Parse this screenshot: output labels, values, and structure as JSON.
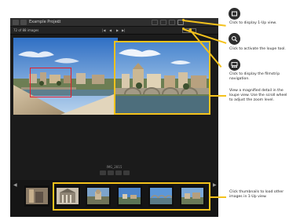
{
  "app": {
    "project_title": "Example Project",
    "count_label": "72 of 88 images",
    "filename": "IMG_2815"
  },
  "nav": {
    "first": "|◀",
    "prev": "◀",
    "next": "▶",
    "last": "▶|"
  },
  "filmstrip": {
    "prev_arrow": "◀",
    "next_arrow": "▶",
    "thumb_count": 6
  },
  "rating": {
    "stars": 4
  },
  "icons": {
    "one_up": "single-frame-icon",
    "loupe": "magnifier-icon",
    "filmstrip": "filmstrip-icon"
  },
  "callouts": {
    "one_up": "Click to display 1-Up view.",
    "loupe_tool": "Click to activate the loupe tool.",
    "filmstrip": "Click to display the filmstrip navigation.",
    "loupe_detail": "View a magnified detail in the loupe view. Use the scroll wheel to adjust the zoom level.",
    "thumbnails": "Click thumbnails to load other images in 1-Up view."
  },
  "colors": {
    "accent": "#f4c21c",
    "zoom_box": "#e3202e",
    "app_bg": "#1b1b1b"
  }
}
